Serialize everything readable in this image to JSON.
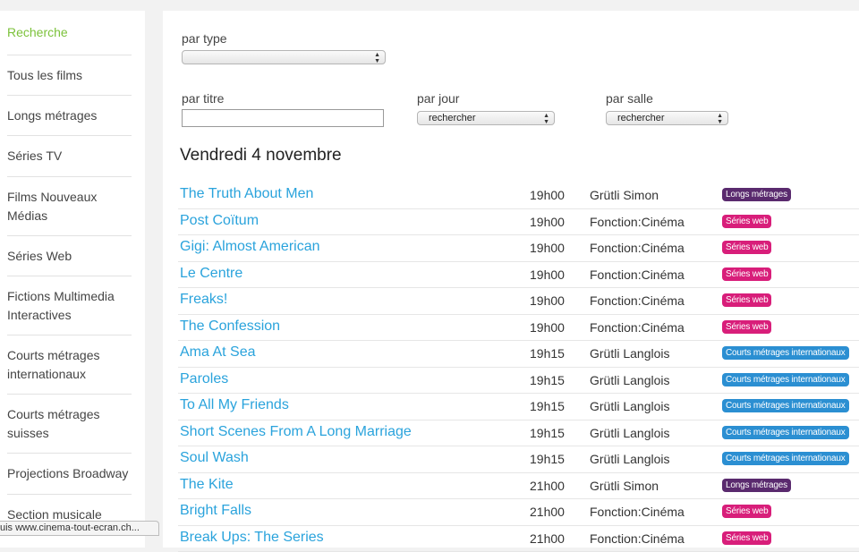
{
  "sidebar": {
    "items": [
      {
        "label": "Recherche",
        "active": true
      },
      {
        "label": "Tous les films"
      },
      {
        "label": "Longs métrages"
      },
      {
        "label": "Séries TV"
      },
      {
        "label": "Films Nouveaux Médias"
      },
      {
        "label": "Séries Web"
      },
      {
        "label": "Fictions Multimedia Interactives"
      },
      {
        "label": "Courts métrages internationaux"
      },
      {
        "label": "Courts métrages suisses"
      },
      {
        "label": "Projections Broadway"
      },
      {
        "label": "Section musicale"
      }
    ]
  },
  "filters": {
    "type_label": "par type",
    "type_value": "",
    "title_label": "par titre",
    "title_value": "",
    "day_label": "par jour",
    "day_value": "rechercher",
    "room_label": "par salle",
    "room_value": "rechercher"
  },
  "schedule": {
    "day_heading": "Vendredi 4 novembre",
    "rows": [
      {
        "title": "The Truth About Men",
        "time": "19h00",
        "venue": "Grütli Simon",
        "category": "Longs métrages",
        "color": "#5a2a6e"
      },
      {
        "title": "Post Coïtum",
        "time": "19h00",
        "venue": "Fonction:Cinéma",
        "category": "Séries web",
        "color": "#d81e7a"
      },
      {
        "title": "Gigi: Almost American",
        "time": "19h00",
        "venue": "Fonction:Cinéma",
        "category": "Séries web",
        "color": "#d81e7a"
      },
      {
        "title": "Le Centre",
        "time": "19h00",
        "venue": "Fonction:Cinéma",
        "category": "Séries web",
        "color": "#d81e7a"
      },
      {
        "title": "Freaks!",
        "time": "19h00",
        "venue": "Fonction:Cinéma",
        "category": "Séries web",
        "color": "#d81e7a"
      },
      {
        "title": "The Confession",
        "time": "19h00",
        "venue": "Fonction:Cinéma",
        "category": "Séries web",
        "color": "#d81e7a"
      },
      {
        "title": "Ama At Sea",
        "time": "19h15",
        "venue": "Grütli Langlois",
        "category": "Courts métrages internationaux",
        "color": "#2b8fd2"
      },
      {
        "title": "Paroles",
        "time": "19h15",
        "venue": "Grütli Langlois",
        "category": "Courts métrages internationaux",
        "color": "#2b8fd2"
      },
      {
        "title": "To All My Friends",
        "time": "19h15",
        "venue": "Grütli Langlois",
        "category": "Courts métrages internationaux",
        "color": "#2b8fd2"
      },
      {
        "title": "Short Scenes From A Long Marriage",
        "time": "19h15",
        "venue": "Grütli Langlois",
        "category": "Courts métrages internationaux",
        "color": "#2b8fd2"
      },
      {
        "title": "Soul Wash",
        "time": "19h15",
        "venue": "Grütli Langlois",
        "category": "Courts métrages internationaux",
        "color": "#2b8fd2"
      },
      {
        "title": "The Kite",
        "time": "21h00",
        "venue": "Grütli Simon",
        "category": "Longs métrages",
        "color": "#5a2a6e"
      },
      {
        "title": "Bright Falls",
        "time": "21h00",
        "venue": "Fonction:Cinéma",
        "category": "Séries web",
        "color": "#d81e7a"
      },
      {
        "title": "Break Ups: The Series",
        "time": "21h00",
        "venue": "Fonction:Cinéma",
        "category": "Séries web",
        "color": "#d81e7a"
      }
    ]
  },
  "status_bar": {
    "text": "uis www.cinema-tout-ecran.ch..."
  }
}
